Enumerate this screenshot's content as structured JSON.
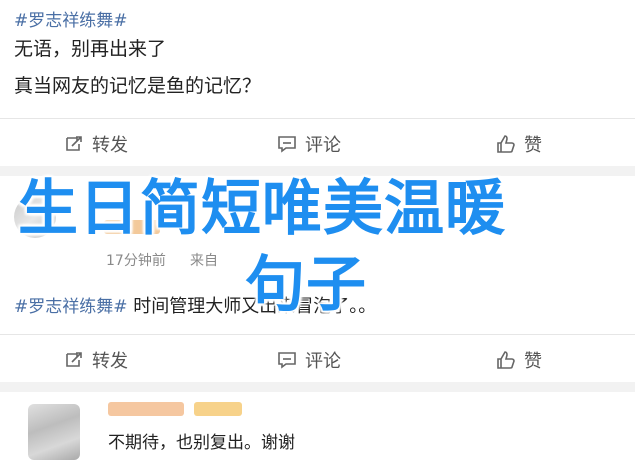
{
  "post1": {
    "hashtag": "#罗志祥练舞#",
    "line1": "无语，别再出来了",
    "line2": "真当网友的记忆是鱼的记忆？"
  },
  "toolbar": {
    "repost": "转发",
    "comment": "评论",
    "like": "赞"
  },
  "comment1": {
    "time": "17分钟前",
    "source": "来自"
  },
  "post2": {
    "hashtag": "#罗志祥练舞#",
    "text": " 时间管理大师又出来冒泡了。。"
  },
  "comment2": {
    "text": "不期待，也别复出。谢谢"
  },
  "overlay": {
    "line1": "生日简短唯美温暖",
    "line2": "句子"
  },
  "colors": {
    "hashtag": "#4a6fa5",
    "overlay": "#1e8ef0"
  }
}
